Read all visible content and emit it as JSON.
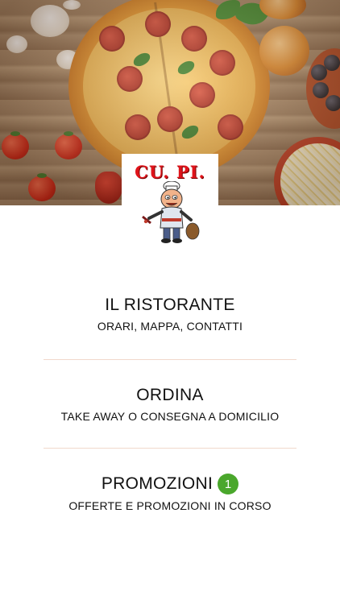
{
  "logo": {
    "text": "CU. PI.",
    "mascot": "chef-mascot-icon"
  },
  "hero": {
    "image": "pizza-ingredients-photo"
  },
  "menu": {
    "items": [
      {
        "title": "IL RISTORANTE",
        "subtitle": "ORARI, MAPPA, CONTATTI"
      },
      {
        "title": "ORDINA",
        "subtitle": "TAKE AWAY O CONSEGNA A DOMICILIO"
      },
      {
        "title": "PROMOZIONI",
        "subtitle": "OFFERTE E PROMOZIONI IN CORSO",
        "badge": "1"
      }
    ]
  },
  "colors": {
    "badge": "#4aa72c",
    "divider": "#f1d8cc",
    "logo_red": "#e0141b"
  }
}
